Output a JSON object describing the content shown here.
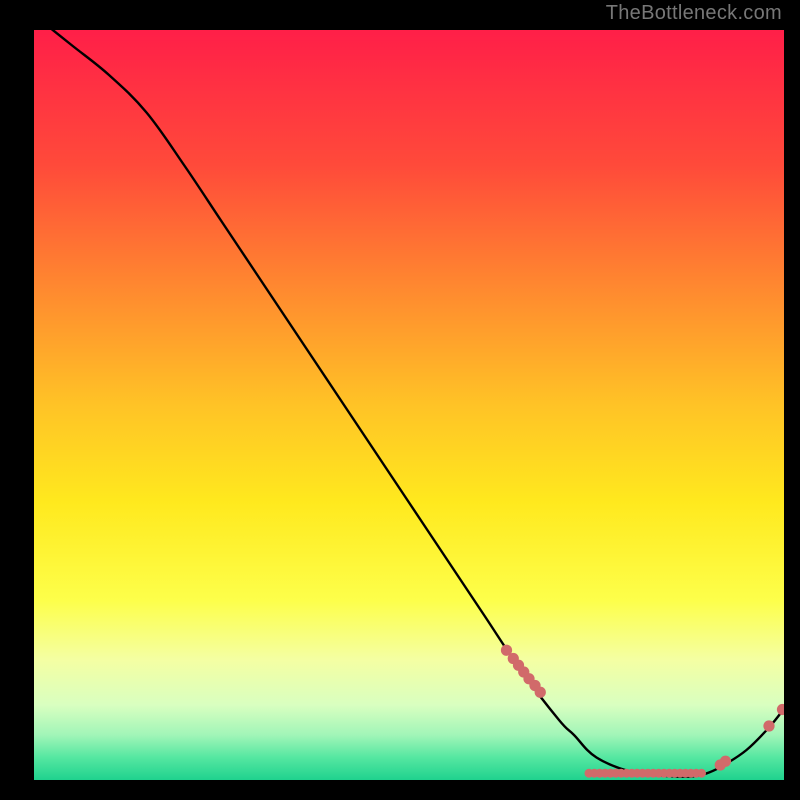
{
  "watermark": "TheBottleneck.com",
  "chart_data": {
    "type": "line",
    "title": "",
    "xlabel": "",
    "ylabel": "",
    "xlim": [
      0,
      100
    ],
    "ylim": [
      0,
      100
    ],
    "grid": false,
    "series": [
      {
        "name": "bottleneck-curve",
        "x": [
          0,
          5,
          10,
          15,
          20,
          25,
          30,
          35,
          40,
          45,
          50,
          55,
          60,
          65,
          70,
          72,
          75,
          80,
          85,
          88,
          90,
          92,
          95,
          98,
          100
        ],
        "y": [
          102,
          98,
          94,
          89,
          82,
          74.5,
          67,
          59.5,
          52,
          44.5,
          37,
          29.5,
          22,
          14.5,
          8,
          6,
          3,
          1,
          0.5,
          0.5,
          1,
          2,
          4,
          7,
          9.5
        ]
      }
    ]
  },
  "gradient": {
    "stops": [
      {
        "pct": 0,
        "hex": "#ff1f48"
      },
      {
        "pct": 18,
        "hex": "#ff4a3a"
      },
      {
        "pct": 35,
        "hex": "#ff8b2f"
      },
      {
        "pct": 50,
        "hex": "#ffc326"
      },
      {
        "pct": 63,
        "hex": "#ffe91e"
      },
      {
        "pct": 76,
        "hex": "#fdff4a"
      },
      {
        "pct": 84,
        "hex": "#f4ffa3"
      },
      {
        "pct": 90,
        "hex": "#d9ffc0"
      },
      {
        "pct": 94,
        "hex": "#a1f5b8"
      },
      {
        "pct": 97,
        "hex": "#55e7a1"
      },
      {
        "pct": 100,
        "hex": "#1fd28e"
      }
    ]
  },
  "marker_color": "#d16a6a",
  "markers_dense": {
    "x": [
      63,
      63.9,
      64.6,
      65.3,
      66,
      66.8,
      67.5
    ],
    "y": [
      17.3,
      16.2,
      15.3,
      14.4,
      13.5,
      12.6,
      11.7
    ]
  },
  "markers_bottomstrip": {
    "x_from": 74,
    "x_to": 89,
    "count": 22,
    "y": 0.9
  },
  "markers_rise": {
    "x": [
      91.5,
      92.2,
      98,
      99.8
    ],
    "y": [
      2.0,
      2.5,
      7.2,
      9.4
    ]
  }
}
